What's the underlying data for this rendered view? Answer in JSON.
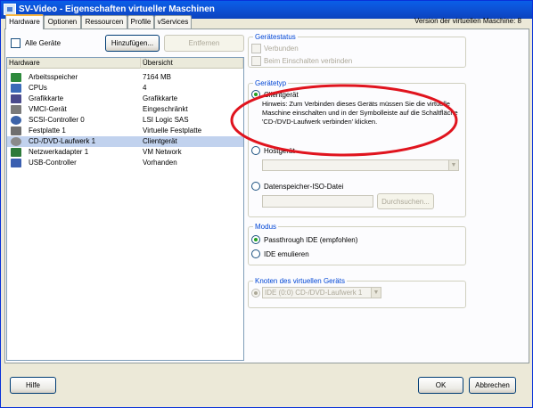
{
  "window": {
    "title": "SV-Video - Eigenschaften virtueller Maschinen",
    "version_label": "Version der virtuellen Maschine: 8"
  },
  "tabs": [
    "Hardware",
    "Optionen",
    "Ressourcen",
    "Profile",
    "vServices"
  ],
  "left": {
    "all_devices": "Alle Geräte",
    "add_button": "Hinzufügen...",
    "remove_button": "Entfernen",
    "columns": [
      "Hardware",
      "Übersicht"
    ],
    "rows": [
      {
        "name": "Arbeitsspeicher",
        "summary": "7164 MB",
        "icon": "memory-icon"
      },
      {
        "name": "CPUs",
        "summary": "4",
        "icon": "cpu-icon"
      },
      {
        "name": "Grafikkarte",
        "summary": "Grafikkarte",
        "icon": "display-icon"
      },
      {
        "name": "VMCI-Gerät",
        "summary": "Eingeschränkt",
        "icon": "vmci-icon"
      },
      {
        "name": "SCSI-Controller 0",
        "summary": "LSI Logic SAS",
        "icon": "scsi-icon"
      },
      {
        "name": "Festplatte 1",
        "summary": "Virtuelle Festplatte",
        "icon": "disk-icon"
      },
      {
        "name": "CD-/DVD-Laufwerk 1",
        "summary": "Clientgerät",
        "icon": "cdrom-icon",
        "selected": true
      },
      {
        "name": "Netzwerkadapter 1",
        "summary": "VM Network",
        "icon": "network-icon"
      },
      {
        "name": "USB-Controller",
        "summary": "Vorhanden",
        "icon": "usb-icon"
      }
    ]
  },
  "device_status": {
    "legend": "Gerätestatus",
    "connected": "Verbunden",
    "connect_on_power": "Beim Einschalten verbinden"
  },
  "device_type": {
    "legend": "Gerätetyp",
    "client": "Clientgerät",
    "hint": "Hinweis: Zum Verbinden dieses Geräts müssen Sie die virtuelle Maschine einschalten und in der Symbolleiste auf die Schaltfläche 'CD-/DVD-Laufwerk verbinden' klicken.",
    "host": "Hostgerät",
    "iso": "Datenspeicher-ISO-Datei",
    "browse": "Durchsuchen..."
  },
  "mode": {
    "legend": "Modus",
    "passthrough": "Passthrough IDE (empfohlen)",
    "emulate": "IDE emulieren"
  },
  "node": {
    "legend": "Knoten des virtuellen Geräts",
    "value": "IDE (0:0) CD-/DVD-Laufwerk 1"
  },
  "footer": {
    "help": "Hilfe",
    "ok": "OK",
    "cancel": "Abbrechen"
  },
  "colors": {
    "annotation": "#e0141e",
    "selection": "#c1d2ee",
    "titlebar": "#0a5fe8"
  }
}
